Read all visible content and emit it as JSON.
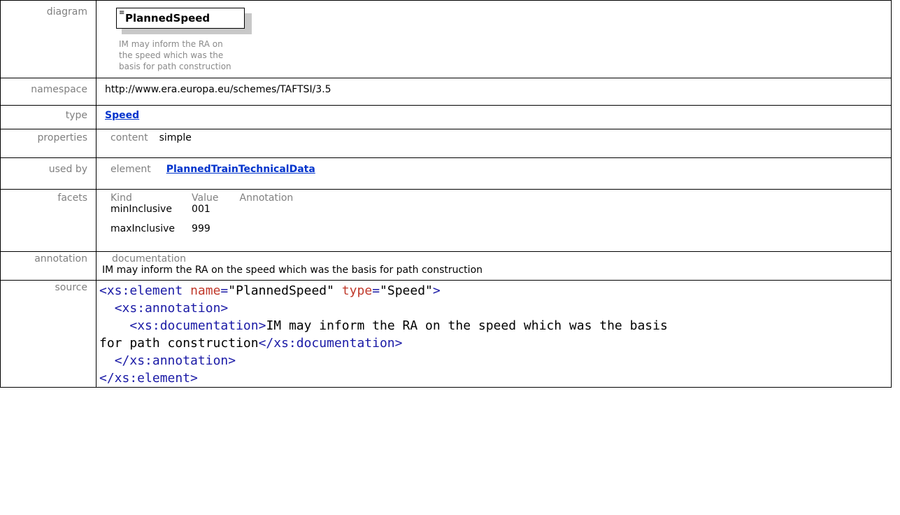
{
  "labels": {
    "diagram": "diagram",
    "namespace": "namespace",
    "type": "type",
    "properties": "properties",
    "used_by": "used by",
    "facets": "facets",
    "annotation": "annotation",
    "source": "source"
  },
  "diagram": {
    "element_name": "PlannedSpeed",
    "note_line1": "IM may inform the RA on",
    "note_line2": "the speed which was the",
    "note_line3": "basis for path construction"
  },
  "namespace": "http://www.era.europa.eu/schemes/TAFTSI/3.5",
  "type": {
    "value": "Speed"
  },
  "properties": {
    "key": "content",
    "value": "simple"
  },
  "used_by": {
    "key": "element",
    "value": "PlannedTrainTechnicalData"
  },
  "facets": {
    "headers": [
      "Kind",
      "Value",
      "Annotation"
    ],
    "rows": [
      {
        "kind": "minInclusive",
        "value": "001",
        "annotation": ""
      },
      {
        "kind": "maxInclusive",
        "value": "999",
        "annotation": ""
      }
    ]
  },
  "annotation": {
    "key": "documentation",
    "text": "IM may inform the RA on the speed which was the basis for path construction"
  },
  "source": {
    "l1_tag_open": "<xs:element",
    "l1_attr1": "name",
    "l1_val1": "\"PlannedSpeed\"",
    "l1_attr2": "type",
    "l1_val2": "\"Speed\"",
    "l1_close": ">",
    "l2": "<xs:annotation>",
    "l3_open": "<xs:documentation>",
    "l3_text": "IM may inform the RA on the speed which was the basis",
    "l4_text": "for path construction",
    "l4_close": "</xs:documentation>",
    "l5": "</xs:annotation>",
    "l6": "</xs:element>"
  }
}
